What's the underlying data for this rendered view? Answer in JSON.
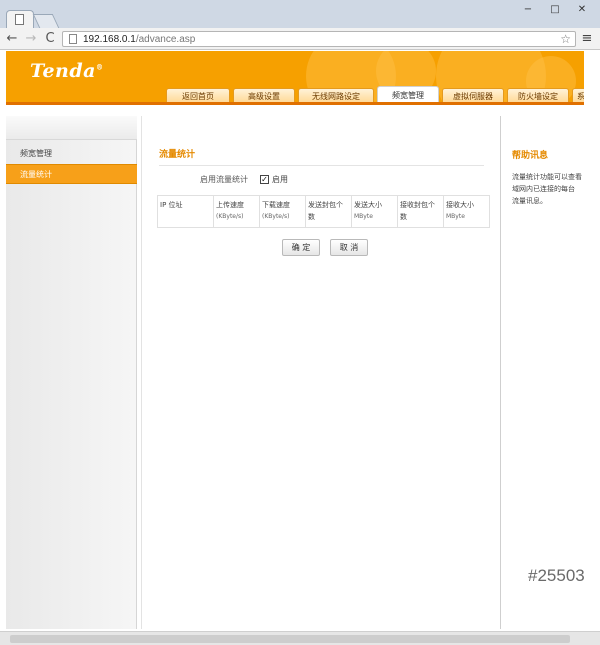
{
  "browser": {
    "url_host": "192.168.0.1",
    "url_path": "/advance.asp",
    "back_icon": "←",
    "forward_icon": "→",
    "reload_icon": "C",
    "star_icon": "☆",
    "menu_icon": "≡",
    "win_minimize": "−",
    "win_maximize": "□",
    "win_close": "✕"
  },
  "brand": {
    "logo": "Tenda",
    "logo_mark": "®"
  },
  "nav": {
    "tabs": [
      "返回首页",
      "高级设置",
      "无线网路设定",
      "频宽管理",
      "虚拟伺服器",
      "防火墙设定",
      "系"
    ],
    "active_index": 3
  },
  "sidebar": {
    "title": "频宽管理",
    "items": [
      "流量统计"
    ]
  },
  "main": {
    "section_title": "流量统计",
    "enable_label": "启用流量统计",
    "enable_value": "启用",
    "enable_checked": "✓",
    "table_headers": [
      {
        "label": "IP 位址",
        "sub": ""
      },
      {
        "label": "上传速度",
        "sub": "(KByte/s)"
      },
      {
        "label": "下载速度",
        "sub": "(KByte/s)"
      },
      {
        "label": "发送封包个数",
        "sub": ""
      },
      {
        "label": "发送大小",
        "sub": "MByte"
      },
      {
        "label": "接收封包个数",
        "sub": ""
      },
      {
        "label": "接收大小",
        "sub": "MByte"
      }
    ],
    "ok_button": "确 定",
    "cancel_button": "取 消"
  },
  "help": {
    "title": "帮助讯息",
    "lines": [
      "流量统计功能可以查看",
      "域网内已连接的每台",
      "流量讯息。"
    ]
  },
  "watermark": "#25503",
  "colors": {
    "accent": "#f6a000",
    "active_item": "#f7a019",
    "section_title": "#e58a00"
  }
}
